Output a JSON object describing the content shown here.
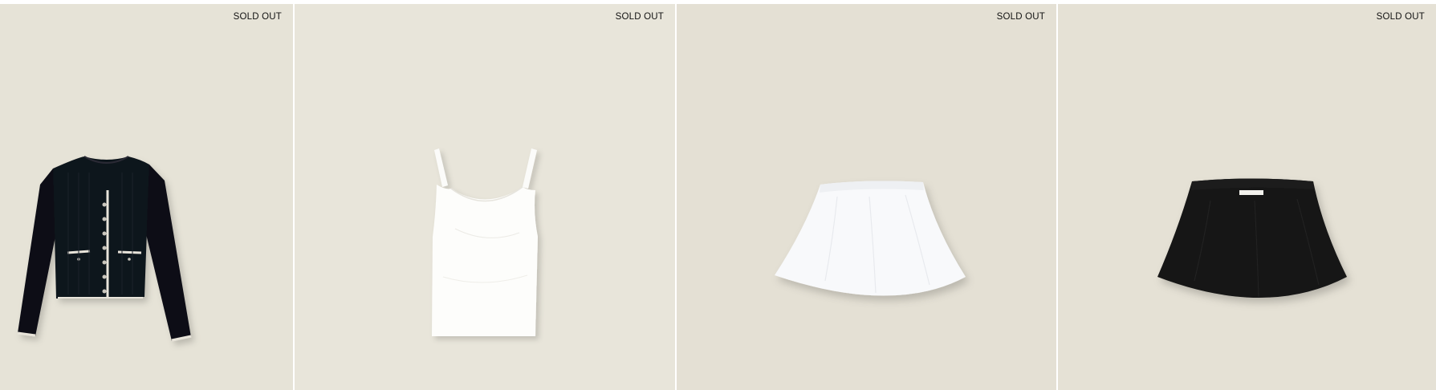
{
  "colors": {
    "card_backgrounds": [
      "#e6e3d7",
      "#e8e5da",
      "#e4e0d4",
      "#e5e1d5"
    ],
    "badge_text": "#111111",
    "divider": "#ffffff"
  },
  "products": [
    {
      "badge": "SOLD OUT",
      "image": "black-cardigan-image",
      "icon": "cardigan-icon"
    },
    {
      "badge": "SOLD OUT",
      "image": "white-tank-top-image",
      "icon": "tank-top-icon"
    },
    {
      "badge": "SOLD OUT",
      "image": "white-mini-skirt-image",
      "icon": "skirt-icon"
    },
    {
      "badge": "SOLD OUT",
      "image": "black-mini-skirt-image",
      "icon": "skirt-icon"
    }
  ]
}
